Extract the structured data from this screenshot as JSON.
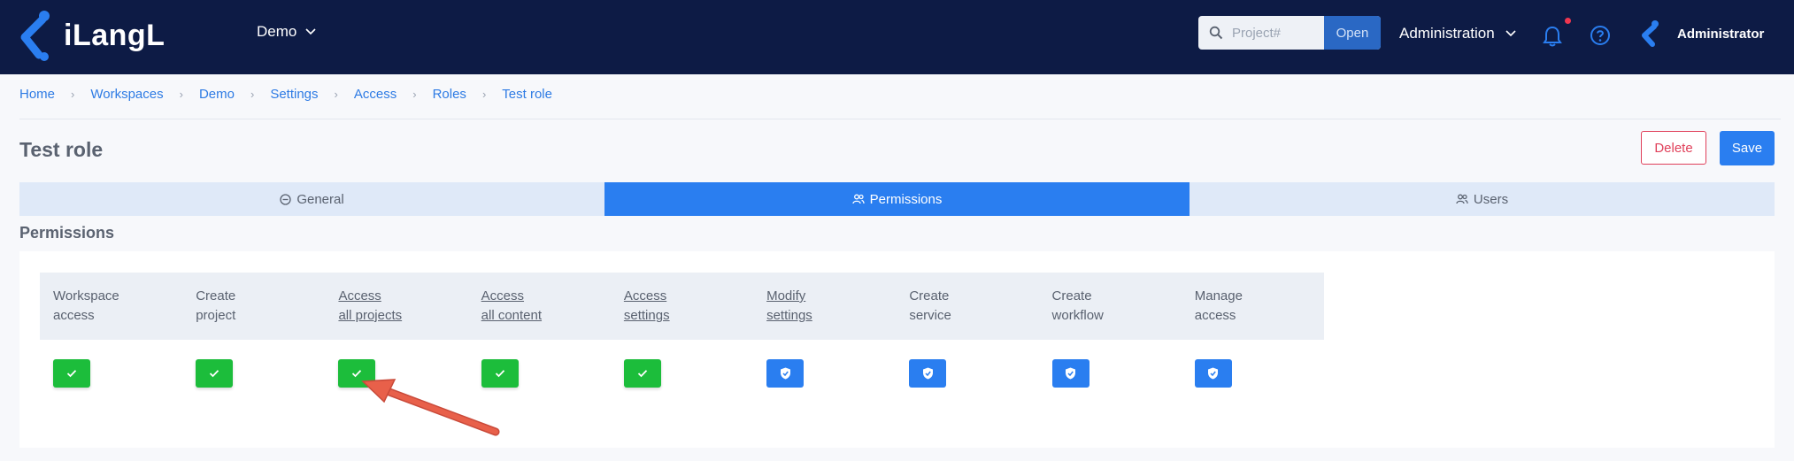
{
  "app": {
    "logo_text": "iLangL",
    "workspace": "Demo",
    "search": {
      "placeholder": "Project#",
      "value": ""
    },
    "open_label": "Open",
    "admin_menu": "Administration",
    "user_name": "Administrator",
    "colors": {
      "navbar": "#0d1b45",
      "accent": "#2a7ef0",
      "granted": "#1cbd3b",
      "danger": "#e0405a",
      "annotation_arrow": "#e8604a"
    }
  },
  "breadcrumb": [
    "Home",
    "Workspaces",
    "Demo",
    "Settings",
    "Access",
    "Roles",
    "Test role"
  ],
  "page": {
    "title": "Test role",
    "delete_label": "Delete",
    "save_label": "Save"
  },
  "tabs": [
    {
      "label": "General",
      "icon": "minus-circle-icon",
      "active": false
    },
    {
      "label": "Permissions",
      "icon": "users-icon",
      "active": true
    },
    {
      "label": "Users",
      "icon": "users-icon",
      "active": false
    }
  ],
  "permissions": {
    "title": "Permissions",
    "columns": [
      {
        "line1": "Workspace",
        "line2": "access",
        "link": false,
        "state": "granted",
        "icon": "check-icon"
      },
      {
        "line1": "Create",
        "line2": "project",
        "link": false,
        "state": "granted",
        "icon": "check-icon"
      },
      {
        "line1": "Access",
        "line2": "all projects",
        "link": true,
        "state": "granted",
        "icon": "check-icon"
      },
      {
        "line1": "Access",
        "line2": "all content",
        "link": true,
        "state": "granted",
        "icon": "check-icon"
      },
      {
        "line1": "Access",
        "line2": "settings",
        "link": true,
        "state": "granted",
        "icon": "check-icon"
      },
      {
        "line1": "Modify",
        "line2": "settings",
        "link": true,
        "state": "restricted",
        "icon": "shield-icon"
      },
      {
        "line1": "Create",
        "line2": "service",
        "link": false,
        "state": "restricted",
        "icon": "shield-icon"
      },
      {
        "line1": "Create",
        "line2": "workflow",
        "link": false,
        "state": "restricted",
        "icon": "shield-icon"
      },
      {
        "line1": "Manage",
        "line2": "access",
        "link": false,
        "state": "restricted",
        "icon": "shield-icon"
      }
    ]
  }
}
